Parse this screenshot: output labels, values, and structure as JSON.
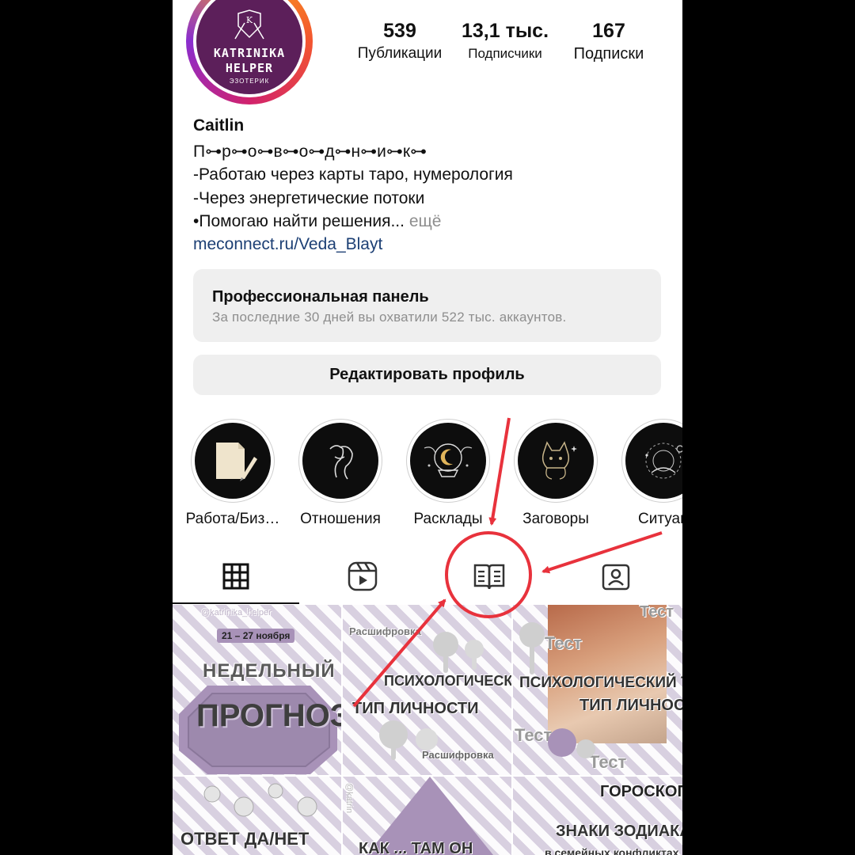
{
  "profile": {
    "avatar_line1": "KATRINIKA",
    "avatar_line2": "HELPER",
    "avatar_line3": "ЭЗОТЕРИК",
    "avatar_letter": "K",
    "name": "Caitlin",
    "bio": [
      "П⊶р⊶о⊶в⊶о⊶д⊶н⊶и⊶к⊶",
      "-Работаю через карты таро, нумерология",
      "-Через энергетические потоки",
      "•Помогаю найти решения..."
    ],
    "more_label": "ещё",
    "link": "meconnect.ru/Veda_Blayt"
  },
  "stats": {
    "posts": {
      "value": "539",
      "label": "Публикации"
    },
    "followers": {
      "value": "13,1 тыс.",
      "label": "Подписчики"
    },
    "following": {
      "value": "167",
      "label": "Подписки"
    }
  },
  "dashboard": {
    "title": "Профессиональная панель",
    "subtitle": "За последние 30 дней вы охватили 522 тыс. аккаунтов."
  },
  "edit_profile_label": "Редактировать профиль",
  "highlights": [
    {
      "label": "Работа/Биз…",
      "icon": "notes-icon"
    },
    {
      "label": "Отношения",
      "icon": "couple-icon"
    },
    {
      "label": "Расклады",
      "icon": "crystal-ball-icon"
    },
    {
      "label": "Заговоры",
      "icon": "cat-icon"
    },
    {
      "label": "Ситуац",
      "icon": "cosmos-icon"
    }
  ],
  "tabs": [
    {
      "name": "grid",
      "icon": "grid-icon",
      "active": true
    },
    {
      "name": "reels",
      "icon": "reels-icon",
      "active": false
    },
    {
      "name": "guides",
      "icon": "guides-icon",
      "active": false
    },
    {
      "name": "tagged",
      "icon": "tagged-icon",
      "active": false
    }
  ],
  "posts": [
    {
      "texts": [
        "@katrinika_helper",
        "21 – 27 ноября",
        "НЕДЕЛЬНЫЙ",
        "ПРОГНОЗ"
      ]
    },
    {
      "texts": [
        "Расшифровка",
        "ПСИХОЛОГИЧЕСКИЙ ТЕСТ",
        "ТИП ЛИЧНОСТИ",
        "Расшифровка"
      ]
    },
    {
      "texts": [
        "Тест",
        "Тест",
        "ПСИХОЛОГИЧЕСКИЙ ТЕСТ:",
        "ТИП ЛИЧНОСТИ,",
        "Тест",
        "Тест"
      ]
    },
    {
      "texts": [
        "ОТВЕТ ДА/НЕТ"
      ]
    },
    {
      "texts": [
        "@katrin",
        "КАК ... ТАМ ОН"
      ]
    },
    {
      "texts": [
        "ГОРОСКОП",
        "ЗНАКИ ЗОДИАКА",
        "в семейных конфликтах"
      ]
    }
  ],
  "colors": {
    "annotation": "#e8323c",
    "link": "#1c3f74",
    "avatar_bg": "#5c1f5a",
    "post_purple": "#a892b8"
  }
}
